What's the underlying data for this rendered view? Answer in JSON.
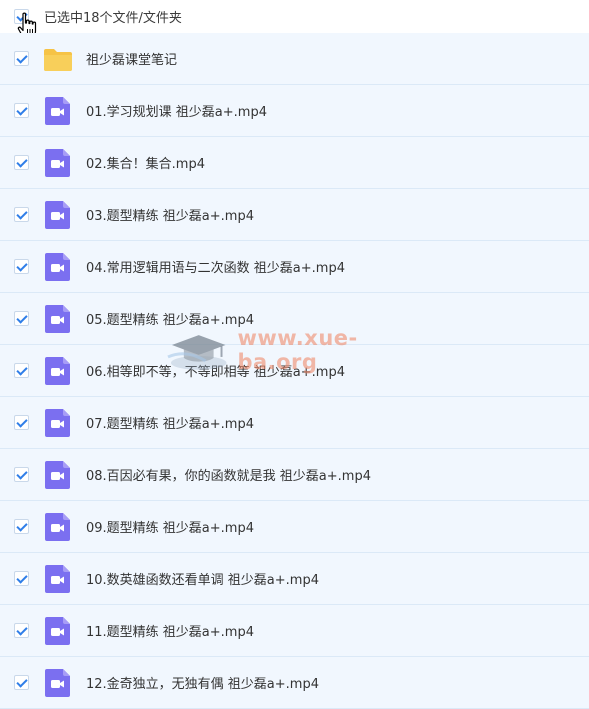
{
  "header": {
    "selection_text": "已选中18个文件/文件夹"
  },
  "files": [
    {
      "name": "祖少磊课堂笔记",
      "type": "folder-icon"
    },
    {
      "name": "01.学习规划课 祖少磊a+.mp4",
      "type": "video-icon"
    },
    {
      "name": "02.集合！集合.mp4",
      "type": "video-icon"
    },
    {
      "name": "03.题型精练 祖少磊a+.mp4",
      "type": "video-icon"
    },
    {
      "name": "04.常用逻辑用语与二次函数 祖少磊a+.mp4",
      "type": "video-icon"
    },
    {
      "name": "05.题型精练 祖少磊a+.mp4",
      "type": "video-icon"
    },
    {
      "name": "06.相等即不等，不等即相等 祖少磊a+.mp4",
      "type": "video-icon"
    },
    {
      "name": "07.题型精练 祖少磊a+.mp4",
      "type": "video-icon"
    },
    {
      "name": "08.百因必有果，你的函数就是我 祖少磊a+.mp4",
      "type": "video-icon"
    },
    {
      "name": "09.题型精练 祖少磊a+.mp4",
      "type": "video-icon"
    },
    {
      "name": "10.数英雄函数还看单调 祖少磊a+.mp4",
      "type": "video-icon"
    },
    {
      "name": "11.题型精练 祖少磊a+.mp4",
      "type": "video-icon"
    },
    {
      "name": "12.金奇独立，无独有偶 祖少磊a+.mp4",
      "type": "video-icon"
    }
  ],
  "watermark": {
    "text": "www.xue-ba.org"
  },
  "colors": {
    "row_bg": "#f1f7fe",
    "check": "#2f7ee8",
    "video": "#7b6ff0",
    "folder": "#f6c346",
    "watermark": "#f08b6c"
  }
}
